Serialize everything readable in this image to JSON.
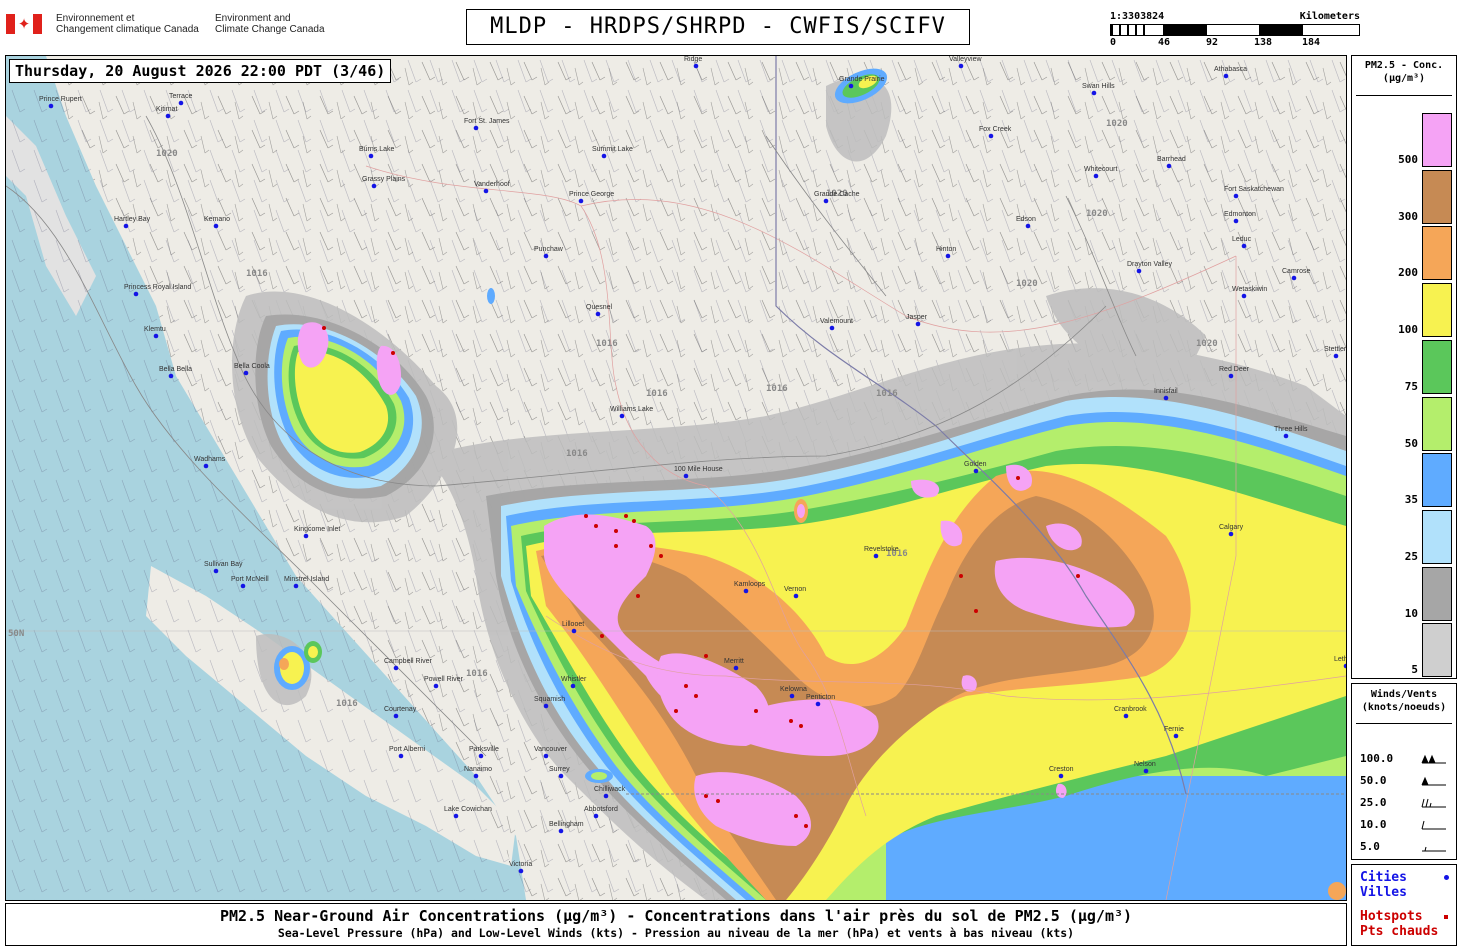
{
  "header": {
    "dept_fr_line1": "Environnement et",
    "dept_fr_line2": "Changement climatique Canada",
    "dept_en_line1": "Environment and",
    "dept_en_line2": "Climate Change Canada",
    "title": "MLDP - HRDPS/SHRPD - CWFIS/SCIFV"
  },
  "scale": {
    "ratio": "1:3303824",
    "unit": "Kilometers",
    "ticks": [
      "0",
      "46",
      "92",
      "138",
      "184"
    ]
  },
  "map": {
    "timestamp": "Thursday, 20 August 2026 22:00 PDT (3/46)",
    "lat_label": "50N",
    "isobar_labels": [
      "1016",
      "1020",
      "1024"
    ],
    "cities": [
      {
        "name": "Terrace"
      },
      {
        "name": "Kitimat"
      },
      {
        "name": "Prince Rupert"
      },
      {
        "name": "Hartley Bay"
      },
      {
        "name": "Princess Royal Island"
      },
      {
        "name": "Klemtu"
      },
      {
        "name": "Bella Bella"
      },
      {
        "name": "Bella Coola"
      },
      {
        "name": "Burns Lake"
      },
      {
        "name": "Grassy Plains"
      },
      {
        "name": "Fort St. James"
      },
      {
        "name": "Vanderhoof"
      },
      {
        "name": "Prince George"
      },
      {
        "name": "Summit Lake"
      },
      {
        "name": "Punchaw"
      },
      {
        "name": "Quesnel"
      },
      {
        "name": "Williams Lake"
      },
      {
        "name": "100 Mile House"
      },
      {
        "name": "Valemount"
      },
      {
        "name": "Jasper"
      },
      {
        "name": "Hinton"
      },
      {
        "name": "Edson"
      },
      {
        "name": "Grande Prairie"
      },
      {
        "name": "Grande Cache"
      },
      {
        "name": "Fox Creek"
      },
      {
        "name": "Whitecourt"
      },
      {
        "name": "Swan Hills"
      },
      {
        "name": "Barrhead"
      },
      {
        "name": "Athabasca"
      },
      {
        "name": "Fort Saskatchewan"
      },
      {
        "name": "Edmonton"
      },
      {
        "name": "Leduc"
      },
      {
        "name": "Camrose"
      },
      {
        "name": "Wetaskiwin"
      },
      {
        "name": "Drayton Valley"
      },
      {
        "name": "Red Deer"
      },
      {
        "name": "Three Hills"
      },
      {
        "name": "Calgary"
      },
      {
        "name": "Kamloops"
      },
      {
        "name": "Merritt"
      },
      {
        "name": "Penticton"
      },
      {
        "name": "Kelowna"
      },
      {
        "name": "Vernon"
      },
      {
        "name": "Revelstoke"
      },
      {
        "name": "Golden"
      },
      {
        "name": "Cranbrook"
      },
      {
        "name": "Fernie"
      },
      {
        "name": "Nelson"
      },
      {
        "name": "Creston"
      },
      {
        "name": "Lillooet"
      },
      {
        "name": "Whistler"
      },
      {
        "name": "Squamish"
      },
      {
        "name": "Vancouver"
      },
      {
        "name": "Surrey"
      },
      {
        "name": "Chilliwack"
      },
      {
        "name": "Abbotsford"
      },
      {
        "name": "Bellingham"
      },
      {
        "name": "Victoria"
      },
      {
        "name": "Nanaimo"
      },
      {
        "name": "Parksville"
      },
      {
        "name": "Port Alberni"
      },
      {
        "name": "Courtenay"
      },
      {
        "name": "Campbell River"
      },
      {
        "name": "Powell River"
      },
      {
        "name": "Port McNeill"
      },
      {
        "name": "Sullivan Bay"
      },
      {
        "name": "Kingcome Inlet"
      },
      {
        "name": "Minstrel Island"
      },
      {
        "name": "Wadhams"
      },
      {
        "name": "Lake Cowichan"
      },
      {
        "name": "Lethbridge"
      },
      {
        "name": "Ridge"
      },
      {
        "name": "Valleyview"
      },
      {
        "name": "Kemano"
      },
      {
        "name": "Stettler"
      },
      {
        "name": "Innisfail"
      }
    ]
  },
  "legend_conc": {
    "header_line1": "PM2.5 - Conc.",
    "header_line2": "(µg/m³)",
    "entries": [
      {
        "label": "500",
        "color": "#f5a3f5"
      },
      {
        "label": "300",
        "color": "#c68a54"
      },
      {
        "label": "200",
        "color": "#f5a658"
      },
      {
        "label": "100",
        "color": "#f7f250"
      },
      {
        "label": "75",
        "color": "#5bc75b"
      },
      {
        "label": "50",
        "color": "#b4ee6c"
      },
      {
        "label": "35",
        "color": "#5fabff"
      },
      {
        "label": "25",
        "color": "#b1e1fb"
      },
      {
        "label": "10",
        "color": "#a6a6a6"
      },
      {
        "label": "5",
        "color": "#cfcfcf"
      }
    ]
  },
  "legend_wind": {
    "header_line1": "Winds/Vents",
    "header_line2": "(knots/noeuds)",
    "entries": [
      "100.0",
      "50.0",
      "25.0",
      "10.0",
      "5.0"
    ]
  },
  "legend_cities": {
    "cities_en": "Cities",
    "cities_fr": "Villes",
    "cities_color": "#1414e6",
    "hotspots_en": "Hotspots",
    "hotspots_fr": "Pts chauds",
    "hotspots_color": "#cc0000"
  },
  "footer": {
    "line1": "PM2.5 Near-Ground Air Concentrations (µg/m³) - Concentrations dans l'air près du sol de PM2.5 (µg/m³)",
    "line2": "Sea-Level Pressure (hPa) and Low-Level Winds (kts) - Pression au niveau de la mer (hPa) et vents à bas niveau (kts)"
  }
}
